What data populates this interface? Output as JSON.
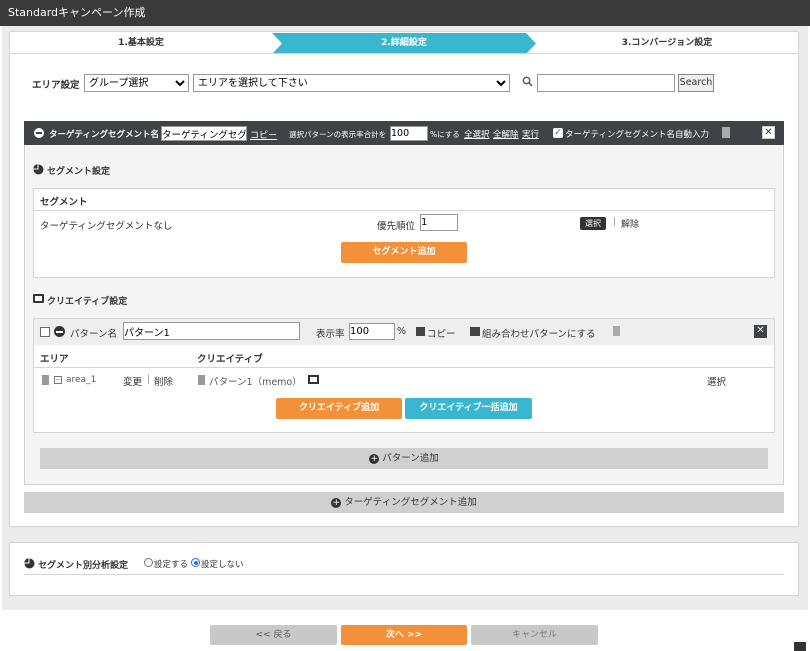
{
  "window": {
    "title": "Standardキャンペーン作成"
  },
  "steps": [
    "1.基本設定",
    "2.詳細設定",
    "3.コンバージョン設定"
  ],
  "area_filter": {
    "label": "エリア設定",
    "group_select": "グループ選択",
    "area_select": "エリアを選択して下さい",
    "search_placeholder": "",
    "search_button": "Search"
  },
  "segment_header": {
    "name_label": "ターゲティングセグメント名",
    "name_value": "ターゲティングセグメ",
    "copy": "コピー",
    "ratio_label": "選択パターンの表示率合計を",
    "ratio_value": "100",
    "ratio_suffix": "%にする",
    "select_all": "全選択",
    "deselect_all": "全解除",
    "execute": "実行",
    "auto_name": "ターゲティングセグメント名自動入力"
  },
  "segment_settings": {
    "title": "セグメント設定",
    "table_header": "セグメント",
    "row_label": "ターゲティングセグメントなし",
    "priority_label": "優先順位",
    "priority_value": "1",
    "select_tag": "選択",
    "release": "解除",
    "add_button": "セグメント追加"
  },
  "creative_settings": {
    "title": "クリエイティブ設定",
    "pattern_label": "パターン名",
    "pattern_value": "パターン1",
    "display_rate_label": "表示率",
    "display_rate_value": "100",
    "percent": "%",
    "copy": "コピー",
    "combine": "組み合わせパターンにする",
    "col_area": "エリア",
    "col_creative": "クリエイティブ",
    "area_name": "area_1",
    "change": "変更",
    "delete": "削除",
    "creative_name": "パターン1（memo）",
    "select": "選択",
    "add_creative": "クリエイティブ追加",
    "bulk_add": "クリエイティブ一括追加",
    "add_pattern": "パターン追加"
  },
  "add_segment": "ターゲティングセグメント追加",
  "analysis": {
    "label": "セグメント別分析設定",
    "opt_set": "設定する",
    "opt_unset": "設定しない"
  },
  "nav": {
    "back": "<< 戻る",
    "next": "次へ >>",
    "cancel": "キャンセル"
  },
  "colors": {
    "accent_orange": "#f2913a",
    "accent_teal": "#3ab6cf",
    "header_dark": "#3f4246"
  }
}
